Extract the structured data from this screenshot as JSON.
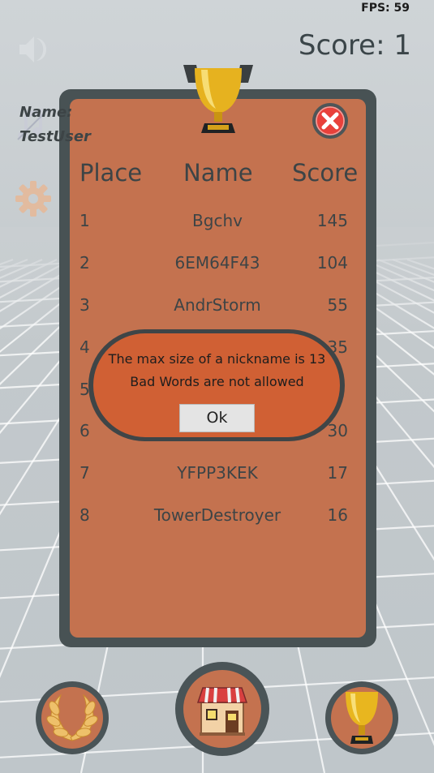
{
  "hud": {
    "fps": "FPS: 59",
    "score": "Score: 1"
  },
  "side_buttons": [
    {
      "name": "sound-icon",
      "state": "on"
    },
    {
      "name": "music-icon",
      "state": "off"
    },
    {
      "name": "gear-icon"
    }
  ],
  "leaderboard": {
    "name_label": "Name:",
    "name_value": "TestUser",
    "headers": {
      "place": "Place",
      "name": "Name",
      "score": "Score"
    },
    "rows": [
      {
        "place": "1",
        "name": "Bgchv",
        "score": "145"
      },
      {
        "place": "2",
        "name": "6EM64F43",
        "score": "104"
      },
      {
        "place": "3",
        "name": "AndrStorm",
        "score": "55"
      },
      {
        "place": "4",
        "name": "",
        "score": "35"
      },
      {
        "place": "5",
        "name": "",
        "score": ""
      },
      {
        "place": "6",
        "name": "",
        "score": "30"
      },
      {
        "place": "7",
        "name": "YFPP3KEK",
        "score": "17"
      },
      {
        "place": "8",
        "name": "TowerDestroyer",
        "score": "16"
      }
    ]
  },
  "dialog": {
    "line1": "The max size of a nickname is 13",
    "line2": "Bad Words are not allowed",
    "ok_label": "Ok"
  },
  "bottom_nav": [
    {
      "name": "laurel-wreath-icon"
    },
    {
      "name": "shop-icon"
    },
    {
      "name": "trophy-icon"
    }
  ],
  "colors": {
    "panel_fill": "#c4724f",
    "panel_border": "#485254",
    "dialog_fill": "#d06034",
    "text": "#3d4446",
    "background": "#c9ced1"
  }
}
